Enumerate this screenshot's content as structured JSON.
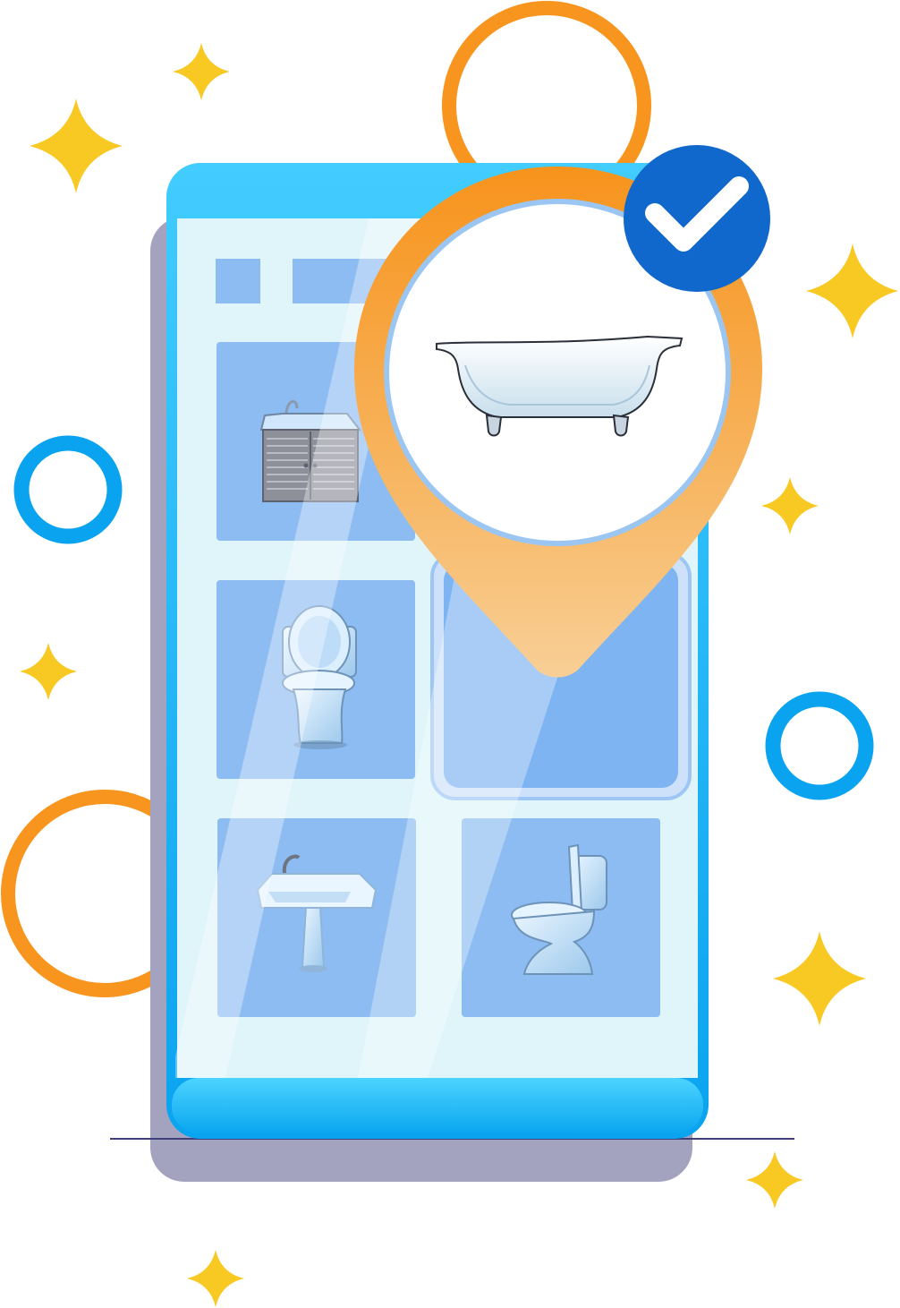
{
  "illustration": {
    "icons": {
      "selected_item": "bathtub-icon",
      "grid_items": [
        "sink-vanity-cabinet-icon",
        "toilet-icon",
        "pedestal-sink-icon",
        "toilet-icon"
      ],
      "badge": "checkmark-icon",
      "pin": "location-pin-icon"
    },
    "colors": {
      "phone_body": "#1aaaf2",
      "phone_shadow": "#a3a3bf",
      "screen_bg": "#dff5f9",
      "tile_blue": "#8cbcf1",
      "pin_orange": "#f7951f",
      "badge_blue": "#1067cc",
      "ring_orange": "#f7951f",
      "ring_blue": "#0aa3f0",
      "sparkle_yellow": "#f8c823"
    },
    "selected_slot": "grid-middle-right"
  }
}
